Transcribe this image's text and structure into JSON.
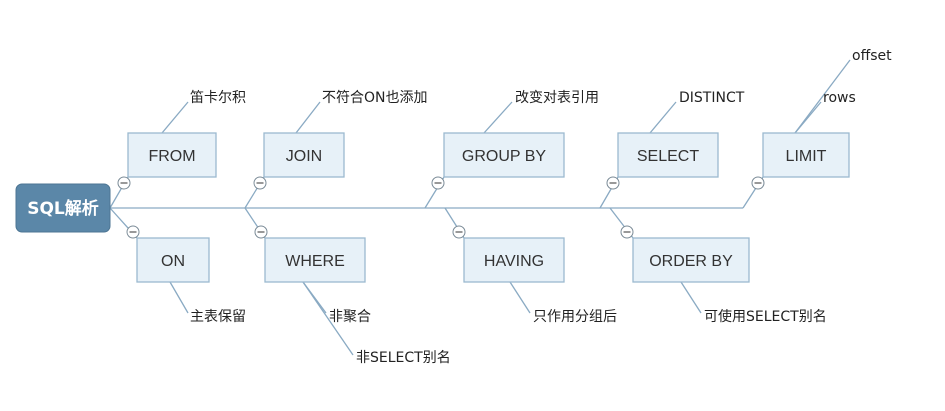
{
  "root": "SQL解析",
  "clauses": {
    "from": "FROM",
    "join": "JOIN",
    "group_by": "GROUP BY",
    "select": "SELECT",
    "limit": "LIMIT",
    "on": "ON",
    "where": "WHERE",
    "having": "HAVING",
    "order_by": "ORDER BY"
  },
  "notes": {
    "from": "笛卡尔积",
    "join": "不符合ON也添加",
    "group_by": "改变对表引用",
    "select": "DISTINCT",
    "limit_rows": "rows",
    "limit_offset": "offset",
    "on": "主表保留",
    "where_1": "非聚合",
    "where_2": "非SELECT别名",
    "having": "只作用分组后",
    "order_by": "可使用SELECT别名"
  },
  "colors": {
    "root_fill": "#5b87a8",
    "box_fill": "#e7f1f8",
    "box_border": "#9cb9cf",
    "line": "#8aaac3"
  }
}
